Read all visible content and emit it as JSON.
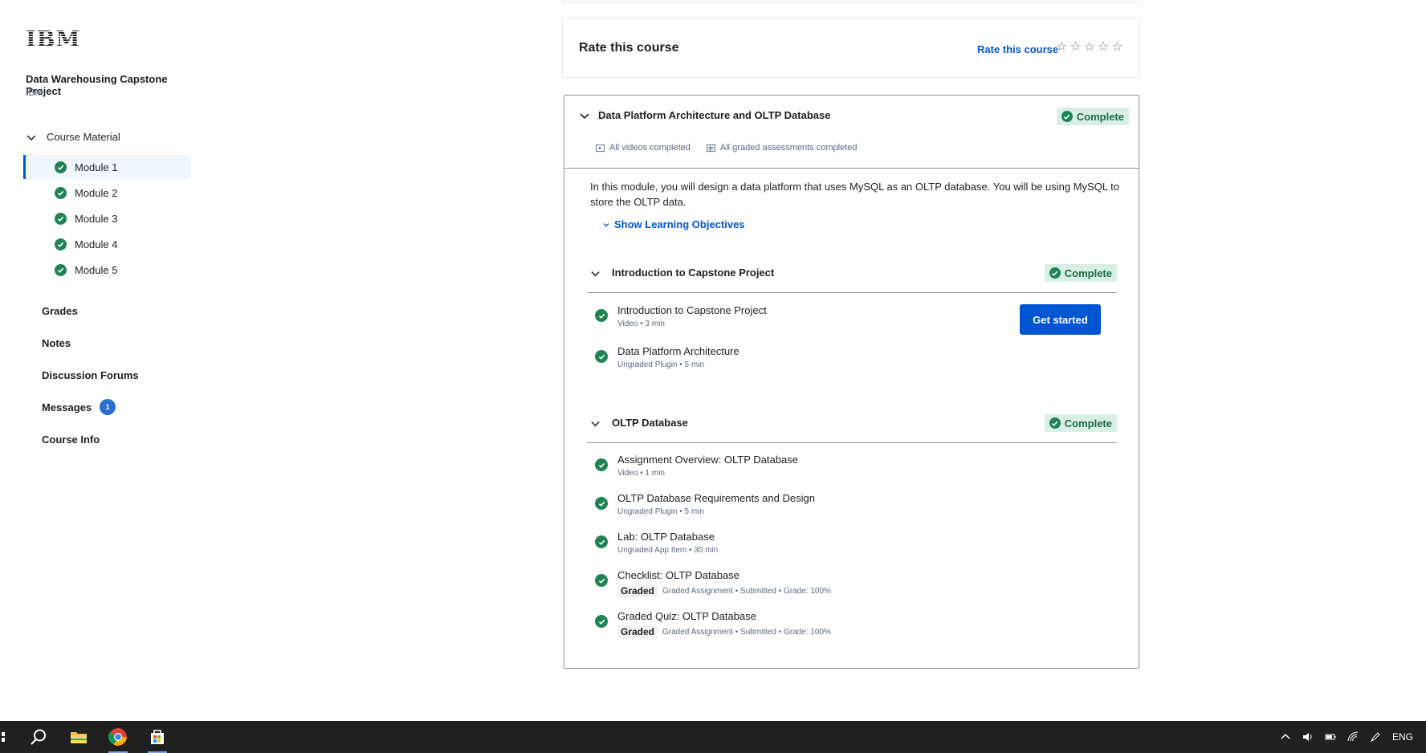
{
  "sidebar": {
    "logo": "IBM",
    "course_title": "Data Warehousing Capstone Project",
    "course_org": "IBM",
    "section_label": "Course Material",
    "modules": [
      {
        "label": "Module 1",
        "active": true
      },
      {
        "label": "Module 2",
        "active": false
      },
      {
        "label": "Module 3",
        "active": false
      },
      {
        "label": "Module 4",
        "active": false
      },
      {
        "label": "Module 5",
        "active": false
      }
    ],
    "links": {
      "grades": "Grades",
      "notes": "Notes",
      "forums": "Discussion Forums",
      "messages": "Messages",
      "messages_badge": "1",
      "course_info": "Course Info"
    }
  },
  "rate": {
    "title": "Rate this course",
    "link": "Rate this course",
    "star_count": 5,
    "rating": 0
  },
  "module": {
    "title": "Data Platform Architecture and OLTP Database",
    "status": "Complete",
    "meta_videos": "All videos completed",
    "meta_assessments": "All graded assessments completed",
    "description": "In this module, you will design a data platform that uses MySQL as an OLTP database. You will be using MySQL to store the OLTP data.",
    "objectives_label": "Show Learning Objectives",
    "lessons": [
      {
        "title": "Introduction to Capstone Project",
        "status": "Complete",
        "items": [
          {
            "name": "Introduction to Capstone Project",
            "sub": "Video • 3 min"
          },
          {
            "name": "Data Platform Architecture",
            "sub": "Ungraded Plugin • 5 min"
          }
        ]
      },
      {
        "title": "OLTP Database",
        "status": "Complete",
        "items": [
          {
            "name": "Assignment Overview: OLTP Database",
            "sub": "Video • 1 min"
          },
          {
            "name": "OLTP Database Requirements and Design",
            "sub": "Ungraded Plugin • 5 min"
          },
          {
            "name": "Lab: OLTP Database",
            "sub": "Ungraded App Item • 30 min"
          },
          {
            "name": "Checklist: OLTP Database",
            "tag": "Graded",
            "sub": "Graded Assignment • Submitted • Grade: 100%"
          },
          {
            "name": "Graded Quiz: OLTP Database",
            "tag": "Graded",
            "sub": "Graded Assignment • Submitted • Grade: 100%"
          }
        ]
      }
    ],
    "cta": "Get started"
  },
  "taskbar": {
    "apps": [
      "start-icon",
      "search-icon",
      "file-explorer-icon",
      "chrome-icon",
      "store-icon"
    ],
    "language": "ENG"
  },
  "colors": {
    "accent": "#0056d2",
    "complete_green": "#1f8354",
    "complete_bg": "#d8efe5",
    "active_module_bg": "#f0f6fc",
    "taskbar": "#202020"
  }
}
